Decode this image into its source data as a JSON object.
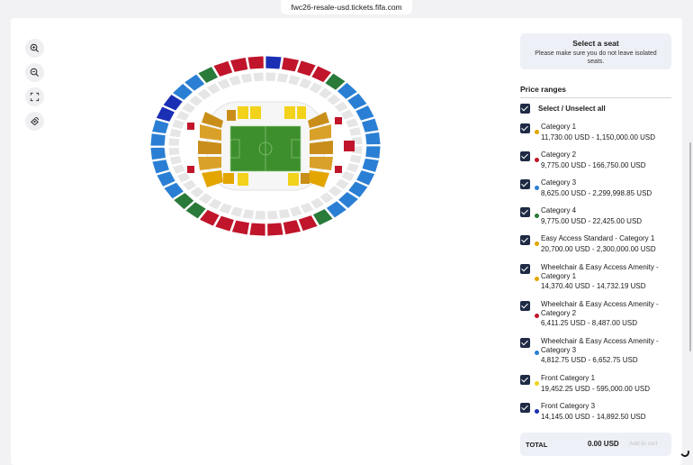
{
  "browser": {
    "url": "fwc26-resale-usd.tickets.fifa.com"
  },
  "map_controls": [
    {
      "name": "zoom-in-icon"
    },
    {
      "name": "zoom-out-icon"
    },
    {
      "name": "fullscreen-icon"
    },
    {
      "name": "reset-view-icon"
    }
  ],
  "seat_prompt": {
    "title": "Select a seat",
    "subtitle": "Please make sure you do not leave isolated seats."
  },
  "price_ranges": {
    "heading": "Price ranges",
    "select_all_label": "Select / Unselect all",
    "items": [
      {
        "name": "Category 1",
        "price": "11,730.00 USD - 1,150,000.00 USD",
        "color": "#e3a500",
        "checked": true
      },
      {
        "name": "Category 2",
        "price": "9,775.00 USD - 166,750.00 USD",
        "color": "#c0152a",
        "checked": true
      },
      {
        "name": "Category 3",
        "price": "8,625.00 USD - 2,299,998.85 USD",
        "color": "#2a7fd4",
        "checked": true
      },
      {
        "name": "Category 4",
        "price": "9,775.00 USD - 22,425.00 USD",
        "color": "#2a7a3a",
        "checked": true
      },
      {
        "name": "Easy Access Standard - Category 1",
        "price": "20,700.00 USD - 2,300,000.00 USD",
        "color": "#e3a500",
        "checked": true
      },
      {
        "name": "Wheelchair & Easy Access Amenity - Category 1",
        "price": "14,370.40 USD - 14,732.19 USD",
        "color": "#e3a500",
        "checked": true
      },
      {
        "name": "Wheelchair & Easy Access Amenity - Category 2",
        "price": "6,411.25 USD - 8,487.00 USD",
        "color": "#c0152a",
        "checked": true
      },
      {
        "name": "Wheelchair & Easy Access Amenity - Category 3",
        "price": "4,812.75 USD - 6,652.75 USD",
        "color": "#2a7fd4",
        "checked": true
      },
      {
        "name": "Front Category 1",
        "price": "19,452.25 USD - 595,000.00 USD",
        "color": "#f2d21a",
        "checked": true
      },
      {
        "name": "Front Category 3",
        "price": "14,145.00 USD - 14,892.50 USD",
        "color": "#1b2fb5",
        "checked": true
      }
    ]
  },
  "footer": {
    "total_label": "TOTAL",
    "total_amount": "0.00 USD",
    "add_to_cart_label": "Add to cart"
  },
  "colors": {
    "cat1": "#e3a500",
    "cat1_light": "#f2d21a",
    "cat2": "#c0152a",
    "cat3": "#2a7fd4",
    "cat3_dark": "#1b2fb5",
    "cat4": "#2a7a3a",
    "pitch": "#3d8f2d",
    "unavailable": "#e6e6e6",
    "panel_bg": "#eef0f7",
    "checkbox": "#1f2a44"
  }
}
